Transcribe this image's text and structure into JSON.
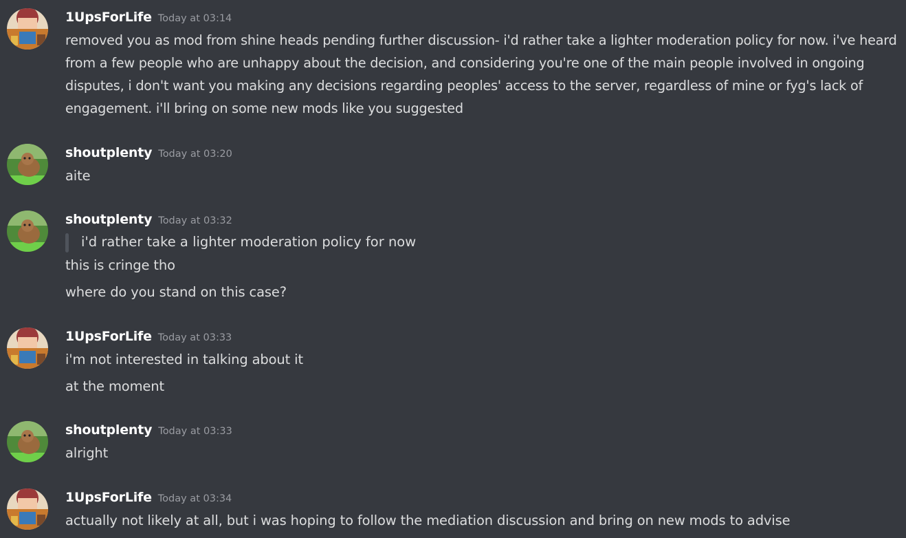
{
  "messages": [
    {
      "author": "1UpsForLife",
      "avatar_icon": "ups-avatar-icon",
      "timestamp": "Today at 03:14",
      "lines": [
        "removed you as mod from shine heads pending further discussion- i'd rather take a lighter moderation policy for now. i've heard from a few people who are unhappy about the decision, and considering you're one of the main people involved in ongoing disputes, i don't want you making any decisions regarding peoples' access to the server, regardless of mine or fyg's lack of engagement. i'll bring on some new mods like you suggested"
      ]
    },
    {
      "author": "shoutplenty",
      "avatar_icon": "dog-avatar-icon",
      "timestamp": "Today at 03:20",
      "lines": [
        "aite"
      ]
    },
    {
      "author": "shoutplenty",
      "avatar_icon": "dog-avatar-icon",
      "timestamp": "Today at 03:32",
      "quote": "i'd rather take a lighter moderation policy for now",
      "lines": [
        "this is cringe tho",
        "where do you stand on this case?"
      ]
    },
    {
      "author": "1UpsForLife",
      "avatar_icon": "ups-avatar-icon",
      "timestamp": "Today at 03:33",
      "lines": [
        "i'm not interested in talking about it",
        "at the moment"
      ]
    },
    {
      "author": "shoutplenty",
      "avatar_icon": "dog-avatar-icon",
      "timestamp": "Today at 03:33",
      "lines": [
        "alright"
      ]
    },
    {
      "author": "1UpsForLife",
      "avatar_icon": "ups-avatar-icon",
      "timestamp": "Today at 03:34",
      "lines": [
        "actually not likely at all, but i was hoping to follow the mediation discussion and bring on new mods to advise"
      ]
    }
  ],
  "colors": {
    "background": "#36393f",
    "username": "#ffffff",
    "timestamp": "#9a9ca2",
    "text": "#dcddde",
    "quote_bar": "#4f545c"
  }
}
